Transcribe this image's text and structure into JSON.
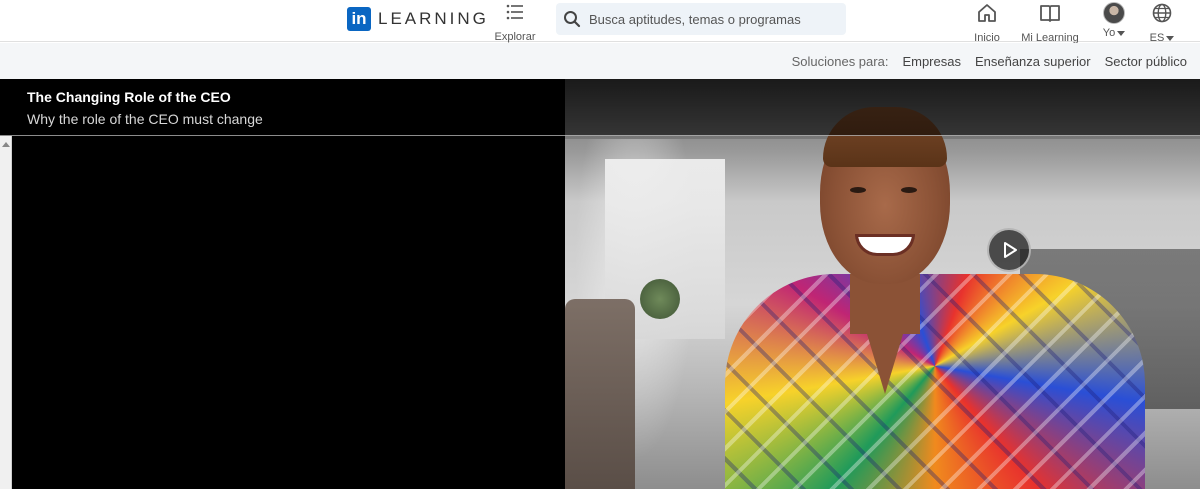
{
  "header": {
    "logo_mark": "in",
    "logo_text": "LEARNING",
    "explore_label": "Explorar",
    "search_placeholder": "Busca aptitudes, temas o programas",
    "nav": {
      "home": "Inicio",
      "my_learning": "Mi Learning",
      "me": "Yo",
      "language": "ES"
    },
    "icons": {
      "explore": "list-icon",
      "search": "search-icon",
      "home": "home-icon",
      "my_learning": "book-icon",
      "language": "globe-icon"
    }
  },
  "solutions": {
    "label": "Soluciones para:",
    "links": [
      "Empresas",
      "Enseñanza superior",
      "Sector público"
    ]
  },
  "video": {
    "title": "The Changing Role of the CEO",
    "subtitle": "Why the role of the CEO must change",
    "play_icon": "play-icon"
  },
  "colors": {
    "brand": "#0a66c2",
    "video_bg": "#000000",
    "solbar_bg": "#f4f6f8"
  }
}
